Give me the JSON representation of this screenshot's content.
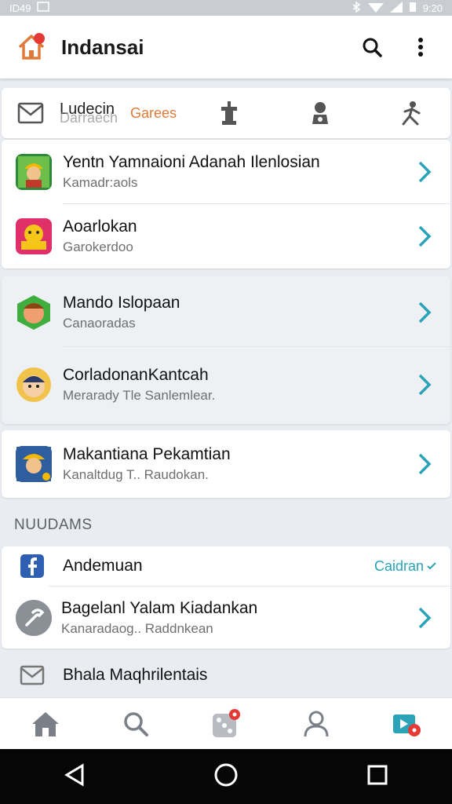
{
  "status_bar": {
    "left_text": "ID49",
    "right_text": "9:20"
  },
  "app_bar": {
    "title": "Indansai",
    "logo_icon": "home-icon",
    "search_icon": "search-icon",
    "menu_icon": "more-vert-icon"
  },
  "tabs": {
    "mail_icon": "mail-icon",
    "tab1_top": "Ludecin",
    "tab1_bottom": "Darraech",
    "tab2": "Garees",
    "icons": [
      "chess-icon",
      "person-icon",
      "figure-icon"
    ]
  },
  "list_group_1": [
    {
      "name": "Yentn Yamnaioni Adanah Ilenlosian",
      "sub": "Kamadr:aols",
      "icon": "worker-game-icon",
      "icon_bg": "#2d8a3a"
    },
    {
      "name": "Aoarlokan",
      "sub": "Garokerdoo",
      "icon": "emoji-game-icon",
      "icon_bg": "#e0306a"
    }
  ],
  "list_group_2": [
    {
      "name": "Mando Islopaan",
      "sub": "Canaoradas",
      "icon": "hero-game-icon",
      "icon_bg": "#3fae3f"
    },
    {
      "name": "CorladonanKantcah",
      "sub": "Merarady Tle Sanlemlear.",
      "icon": "face-game-icon",
      "icon_bg": "#f2c34a"
    }
  ],
  "list_group_3": [
    {
      "name": "Makantiana Pekamtian",
      "sub": "Kanaltdug T.. Raudokan.",
      "icon": "miner-game-icon",
      "icon_bg": "#2f5e9e"
    }
  ],
  "section_title": "NUUDAMS",
  "account_rows": {
    "facebook": {
      "name": "Andemuan",
      "action": "Caidran",
      "icon": "facebook-icon"
    },
    "settings": {
      "name": "Bagelanl Yalam Kiadankan",
      "sub": "Kanaradaog.. Raddnkean",
      "icon": "tool-icon"
    },
    "mail": {
      "name": "Bhala Maqhrilentais",
      "icon": "mail-icon"
    }
  },
  "bottom_nav": [
    "home-icon",
    "search-icon",
    "dice-icon",
    "profile-icon",
    "media-icon"
  ],
  "colors": {
    "accent": "#2aa3b8",
    "orange": "#e07a3a",
    "badge_red": "#e53935"
  }
}
